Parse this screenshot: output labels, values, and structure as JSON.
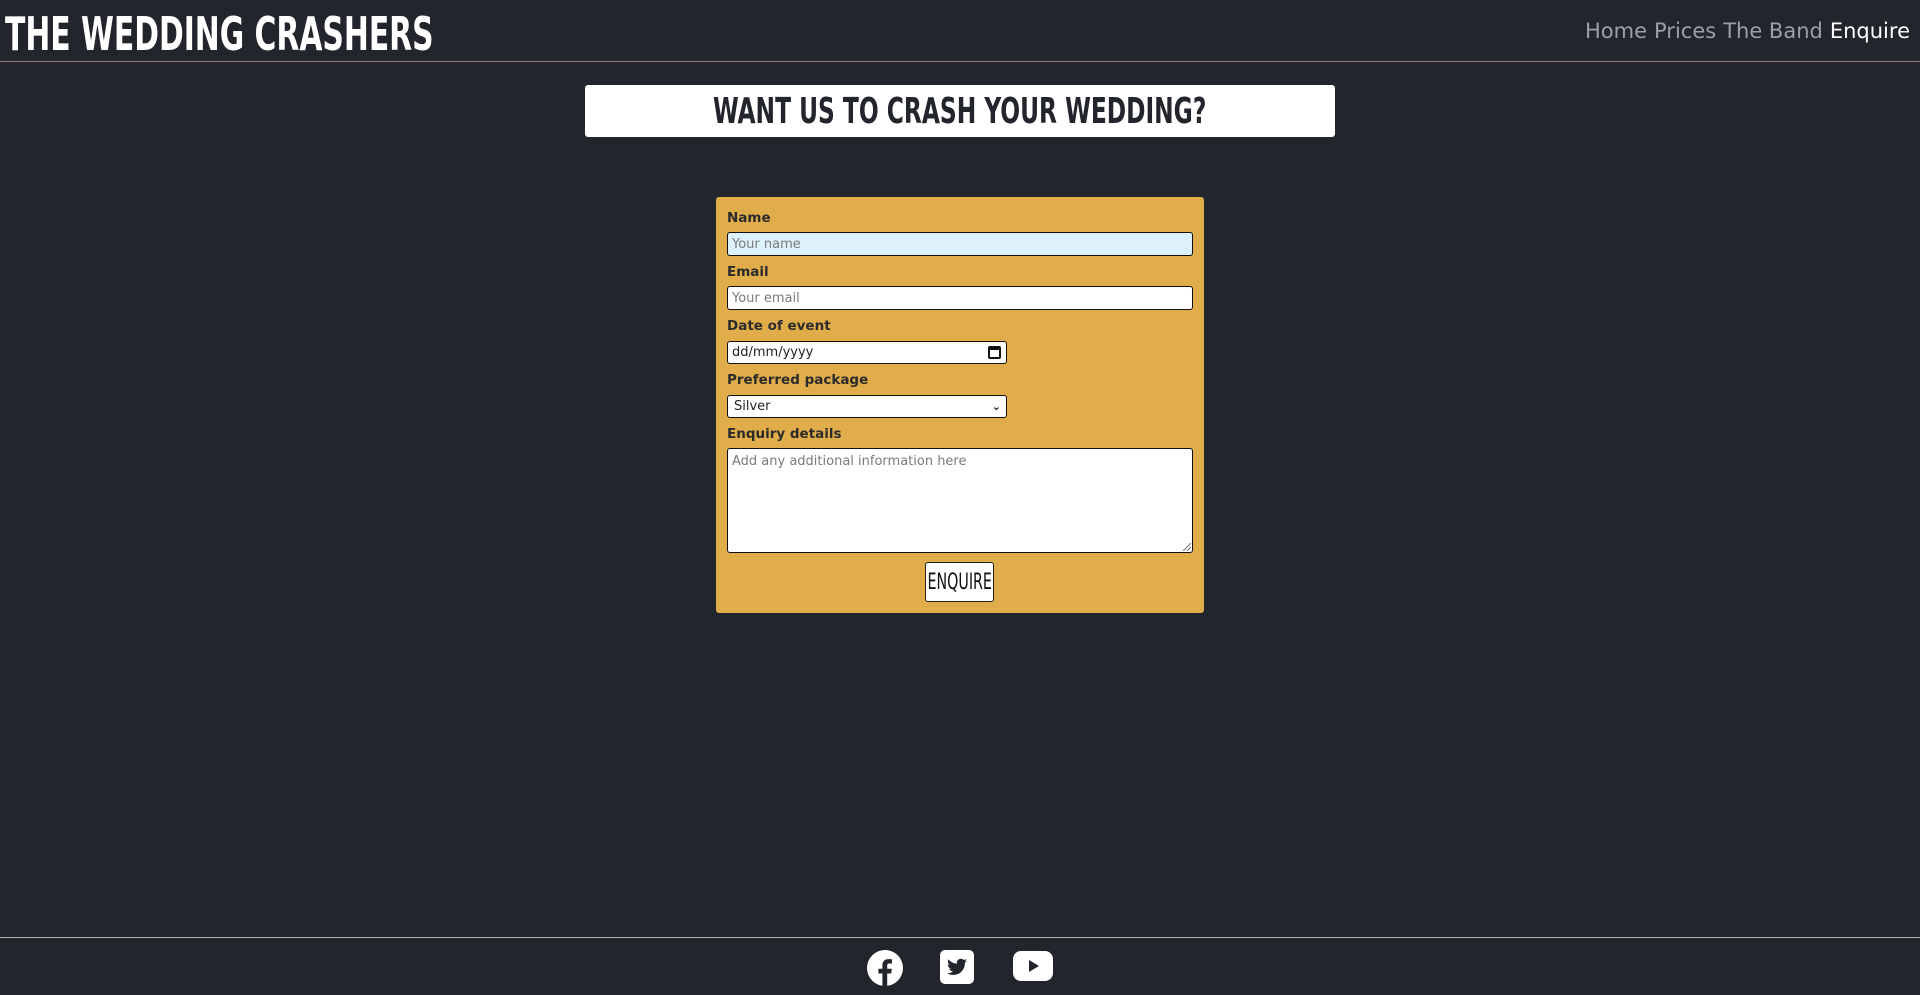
{
  "header": {
    "brand": "THE WEDDING CRASHERS",
    "nav": [
      {
        "label": "Home",
        "active": false
      },
      {
        "label": "Prices",
        "active": false
      },
      {
        "label": "The Band",
        "active": false
      },
      {
        "label": "Enquire",
        "active": true
      }
    ]
  },
  "main": {
    "title": "WANT US TO CRASH YOUR WEDDING?"
  },
  "form": {
    "name": {
      "label": "Name",
      "placeholder": "Your name",
      "value": ""
    },
    "email": {
      "label": "Email",
      "placeholder": "Your email",
      "value": ""
    },
    "date": {
      "label": "Date of event",
      "value": "dd/mm/yyyy"
    },
    "package": {
      "label": "Preferred package",
      "selected": "Silver"
    },
    "details": {
      "label": "Enquiry details",
      "placeholder": "Add any additional information here",
      "value": ""
    },
    "submit_label": "ENQUIRE"
  },
  "footer": {
    "icons": [
      "facebook-icon",
      "twitter-icon",
      "youtube-icon"
    ]
  },
  "colors": {
    "background": "#22252b",
    "form_card": "#e0ad4a",
    "focused_input": "#ddf1fb",
    "nav_inactive": "#9aa0a6",
    "nav_active": "#ffffff"
  }
}
